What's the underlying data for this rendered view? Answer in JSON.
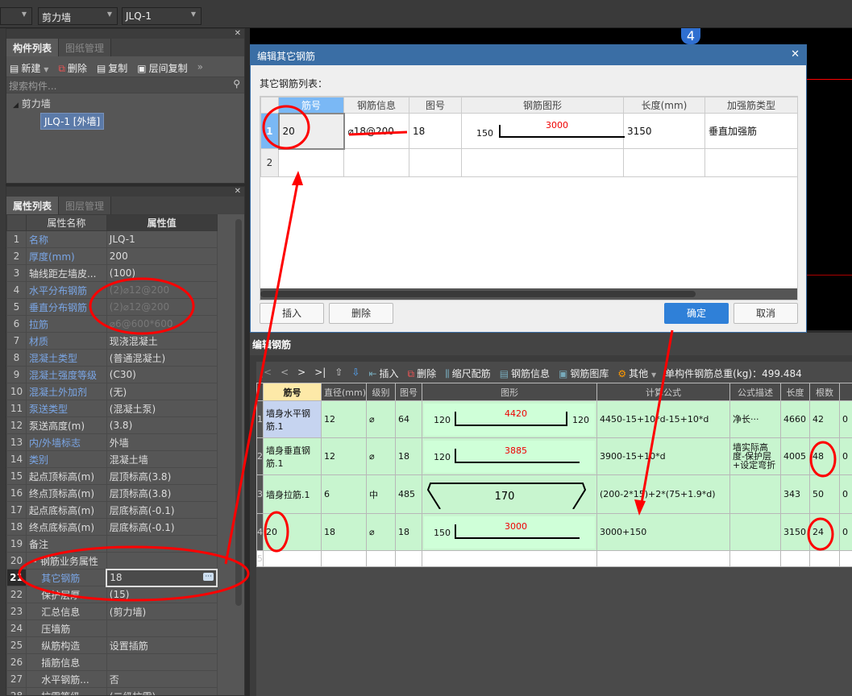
{
  "topbar": {
    "dropdowns": [
      "",
      "剪力墙",
      "JLQ-1"
    ]
  },
  "component_panel": {
    "tabs": [
      "构件列表",
      "图纸管理"
    ],
    "toolbar": [
      "新建",
      "删除",
      "复制",
      "层间复制"
    ],
    "search_placeholder": "搜索构件...",
    "tree": {
      "group": "剪力墙",
      "item": "JLQ-1 [外墙]"
    }
  },
  "property_panel": {
    "tabs": [
      "属性列表",
      "图层管理"
    ],
    "headers": [
      "属性名称",
      "属性值"
    ],
    "rows": [
      {
        "n": "1",
        "k": "名称",
        "v": "JLQ-1",
        "blue": true
      },
      {
        "n": "2",
        "k": "厚度(mm)",
        "v": "200",
        "blue": true
      },
      {
        "n": "3",
        "k": "轴线距左墙皮...",
        "v": "(100)",
        "blue": false
      },
      {
        "n": "4",
        "k": "水平分布钢筋",
        "v": "(2)⌀12@200",
        "blue": true
      },
      {
        "n": "5",
        "k": "垂直分布钢筋",
        "v": "(2)⌀12@200",
        "blue": true
      },
      {
        "n": "6",
        "k": "拉筋",
        "v": "⌀6@600*600",
        "blue": true
      },
      {
        "n": "7",
        "k": "材质",
        "v": "现浇混凝土",
        "blue": true
      },
      {
        "n": "8",
        "k": "混凝土类型",
        "v": "(普通混凝土)",
        "blue": true
      },
      {
        "n": "9",
        "k": "混凝土强度等级",
        "v": "(C30)",
        "blue": true
      },
      {
        "n": "10",
        "k": "混凝土外加剂",
        "v": "(无)",
        "blue": true
      },
      {
        "n": "11",
        "k": "泵送类型",
        "v": "(混凝土泵)",
        "blue": true
      },
      {
        "n": "12",
        "k": "泵送高度(m)",
        "v": "(3.8)",
        "blue": false
      },
      {
        "n": "13",
        "k": "内/外墙标志",
        "v": "外墙",
        "blue": true
      },
      {
        "n": "14",
        "k": "类别",
        "v": "混凝土墙",
        "blue": true
      },
      {
        "n": "15",
        "k": "起点顶标高(m)",
        "v": "层顶标高(3.8)",
        "blue": false
      },
      {
        "n": "16",
        "k": "终点顶标高(m)",
        "v": "层顶标高(3.8)",
        "blue": false
      },
      {
        "n": "17",
        "k": "起点底标高(m)",
        "v": "层底标高(-0.1)",
        "blue": false
      },
      {
        "n": "18",
        "k": "终点底标高(m)",
        "v": "层底标高(-0.1)",
        "blue": false
      },
      {
        "n": "19",
        "k": "备注",
        "v": "",
        "blue": false
      },
      {
        "n": "20",
        "k": "− 钢筋业务属性",
        "v": "",
        "blue": false
      },
      {
        "n": "21",
        "k": "    其它钢筋",
        "v": "18",
        "blue": true
      },
      {
        "n": "22",
        "k": "    保护层厚...",
        "v": "(15)",
        "blue": false
      },
      {
        "n": "23",
        "k": "    汇总信息",
        "v": "(剪力墙)",
        "blue": false
      },
      {
        "n": "24",
        "k": "    压墙筋",
        "v": "",
        "blue": false
      },
      {
        "n": "25",
        "k": "    纵筋构造",
        "v": "设置插筋",
        "blue": false
      },
      {
        "n": "26",
        "k": "    插筋信息",
        "v": "",
        "blue": false
      },
      {
        "n": "27",
        "k": "    水平钢筋...",
        "v": "否",
        "blue": false
      },
      {
        "n": "28",
        "k": "    抗震等级",
        "v": "(二级抗震)",
        "blue": false
      }
    ]
  },
  "canvas": {
    "axis_label": "4"
  },
  "dialog": {
    "title": "编辑其它钢筋",
    "list_label": "其它钢筋列表：",
    "headers": [
      "筋号",
      "钢筋信息",
      "图号",
      "钢筋图形",
      "长度(mm)",
      "加强筋类型"
    ],
    "rows": [
      {
        "n": "1",
        "id": "20",
        "info": "⌀18@200",
        "fig": "18",
        "shape_left": "150",
        "shape_mid": "3000",
        "len": "3150",
        "type": "垂直加强筋"
      },
      {
        "n": "2"
      }
    ],
    "buttons": {
      "insert": "插入",
      "delete": "删除",
      "ok": "确定",
      "cancel": "取消"
    }
  },
  "rebar_editor": {
    "title": "编辑钢筋",
    "nav": [
      "|<",
      "<",
      ">",
      ">|"
    ],
    "toolbar": [
      "插入",
      "删除",
      "缩尺配筋",
      "钢筋信息",
      "钢筋图库",
      "其他"
    ],
    "total_weight": "单构件钢筋总重(kg)：499.484",
    "headers": [
      "筋号",
      "直径(mm)",
      "级别",
      "图号",
      "图形",
      "计算公式",
      "公式描述",
      "长度",
      "根数",
      ""
    ],
    "rows": [
      {
        "n": "1",
        "id": "墙身水平钢筋.1",
        "d": "12",
        "g": "⌀",
        "fig": "64",
        "sl": "120",
        "sm": "4420",
        "sr": "120",
        "formula": "4450-15+10*d-15+10*d",
        "desc": "净长···",
        "len": "4660",
        "cnt": "42",
        "x": "0"
      },
      {
        "n": "2",
        "id": "墙身垂直钢筋.1",
        "d": "12",
        "g": "⌀",
        "fig": "18",
        "sl": "120",
        "sm": "3885",
        "sr": "",
        "formula": "3900-15+10*d",
        "desc": "墙实际高度-保护层+设定弯折",
        "len": "4005",
        "cnt": "48",
        "x": "0"
      },
      {
        "n": "3",
        "id": "墙身拉筋.1",
        "d": "6",
        "g": "中",
        "fig": "485",
        "sl": "",
        "sm": "170",
        "sr": "",
        "formula": "(200-2*15)+2*(75+1.9*d)",
        "desc": "",
        "len": "343",
        "cnt": "50",
        "x": "0"
      },
      {
        "n": "4",
        "id": "20",
        "d": "18",
        "g": "⌀",
        "fig": "18",
        "sl": "150",
        "sm": "3000",
        "sr": "",
        "formula": "3000+150",
        "desc": "",
        "len": "3150",
        "cnt": "24",
        "x": "0"
      },
      {
        "n": "5",
        "id": "",
        "d": "",
        "g": "",
        "fig": "",
        "sl": "",
        "sm": "",
        "sr": "",
        "formula": "",
        "desc": "",
        "len": "",
        "cnt": "",
        "x": ""
      }
    ]
  },
  "colors": {
    "dialog_title": "#3a6ea5",
    "ok_button": "#2f80d8",
    "row_green": "#c8f5cf",
    "annotation": "#ff0000",
    "property_blue": "#7aa6e6"
  }
}
